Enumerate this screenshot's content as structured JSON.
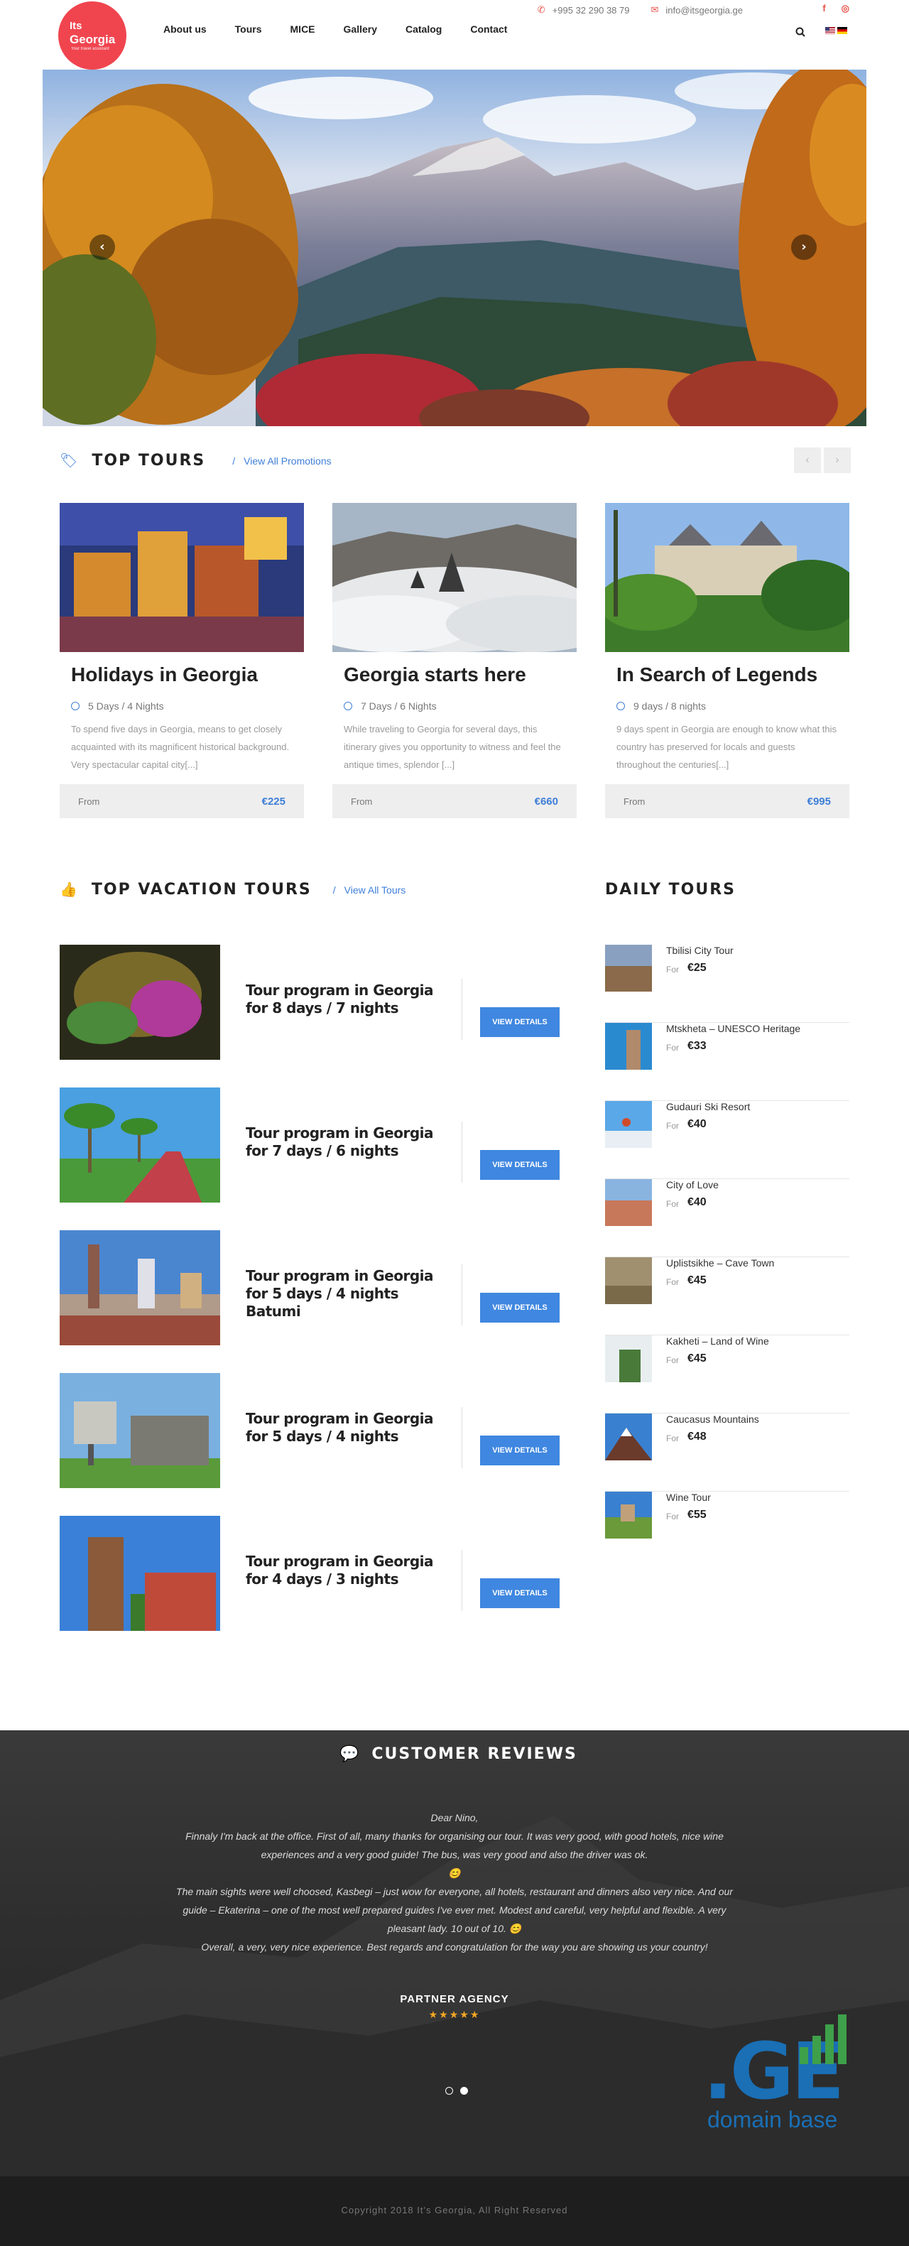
{
  "brand": {
    "name_line1": "Its",
    "name_line2": "Georgia",
    "tagline": "Your travel assistant",
    "color": "#f0454f"
  },
  "nav": [
    "About us",
    "Tours",
    "MICE",
    "Gallery",
    "Catalog",
    "Contact"
  ],
  "contact": {
    "phone": "+995 32 290 38 79",
    "email": "info@itsgeorgia.ge"
  },
  "social": {
    "facebook": "f",
    "instagram": "◎"
  },
  "hero": {
    "prev": "‹",
    "next": "›"
  },
  "top_tours": {
    "title": "TOP TOURS",
    "link": "View All Promotions",
    "prev": "‹",
    "next": "›",
    "cards": [
      {
        "title": "Holidays in Georgia",
        "duration": "5 Days / 4 Nights",
        "desc": "To spend five days in Georgia, means to get closely acquainted with its magnificent historical background. Very spectacular capital city[...]",
        "from": "From",
        "price": "€225"
      },
      {
        "title": "Georgia starts here",
        "duration": "7 Days / 6 Nights",
        "desc": "While traveling to Georgia for several days, this itinerary gives you opportunity to witness and feel the antique times, splendor [...]",
        "from": "From",
        "price": "€660"
      },
      {
        "title": "In Search of Legends",
        "duration": "9 days / 8 nights",
        "desc": "9 days spent in Georgia are enough to know what this country has preserved for locals and guests throughout the centuries[...]",
        "from": "From",
        "price": "€995"
      }
    ]
  },
  "vacation": {
    "title": "TOP VACATION TOURS",
    "link": "View All Tours",
    "button": "VIEW DETAILS",
    "items": [
      {
        "title": "Tour program in Georgia for 8 days / 7 nights"
      },
      {
        "title": "Tour program in Georgia for 7 days / 6 nights"
      },
      {
        "title": "Tour program in Georgia for 5 days / 4 nights Batumi"
      },
      {
        "title": "Tour program in Georgia for 5 days / 4 nights"
      },
      {
        "title": "Tour program in Georgia for 4 days / 3 nights"
      }
    ]
  },
  "daily": {
    "title": "DAILY TOURS",
    "for_label": "For",
    "items": [
      {
        "name": "Tbilisi City Tour",
        "price": "€25"
      },
      {
        "name": "Mtskheta – UNESCO Heritage",
        "price": "€33"
      },
      {
        "name": "Gudauri Ski Resort",
        "price": "€40"
      },
      {
        "name": "City of Love",
        "price": "€40"
      },
      {
        "name": "Uplistsikhe – Cave Town",
        "price": "€45"
      },
      {
        "name": "Kakheti – Land of Wine",
        "price": "€45"
      },
      {
        "name": "Caucasus Mountains",
        "price": "€48"
      },
      {
        "name": "Wine Tour",
        "price": "€55"
      }
    ]
  },
  "reviews": {
    "title": "CUSTOMER REVIEWS",
    "lines": [
      "Dear Nino,",
      "Finnaly I'm back at the office. First of all, many thanks for organising our tour. It was very good, with good hotels, nice wine experiences and a very good guide! The bus, was very good and also the driver was ok.",
      "😊",
      "The main sights were well choosed, Kasbegi – just wow for everyone, all hotels, restaurant and dinners also very nice. And our guide – Ekaterina – one of the most well prepared guides I've ever met. Modest and careful, very helpful and flexible. A very pleasant lady. 10 out of 10. 😊",
      "Overall, a very, very nice experience. Best regards and congratulation for the way you are showing us your country!"
    ],
    "author": "PARTNER AGENCY",
    "stars": "★★★★★",
    "rating": 5
  },
  "watermark": {
    "mark": ".GE",
    "text": "domain base"
  },
  "footer": "Copyright 2018 It's Georgia, All Right Reserved",
  "colors": {
    "accent": "#3f7fd8",
    "button": "#3f87e0",
    "contact_icon": "#e8514a"
  }
}
